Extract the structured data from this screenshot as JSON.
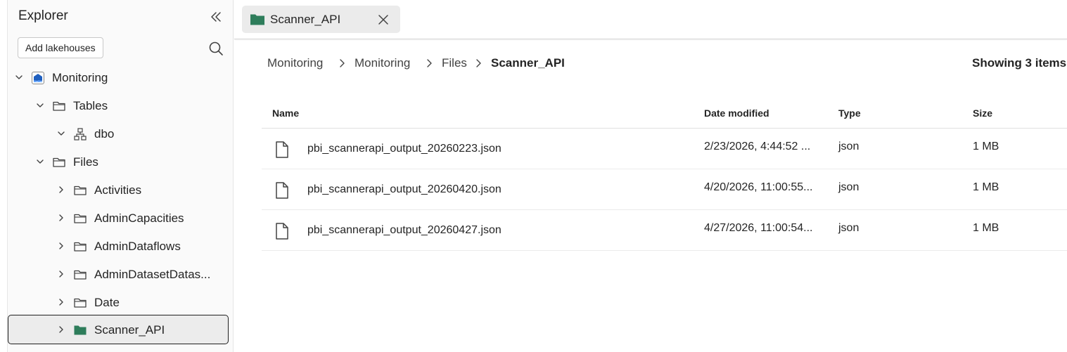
{
  "explorer": {
    "title": "Explorer",
    "add_button": "Add lakehouses",
    "tree": [
      {
        "label": "Monitoring",
        "icon": "lakehouse-icon",
        "expanded": true
      },
      {
        "label": "Tables",
        "icon": "folder-icon",
        "expanded": true
      },
      {
        "label": "dbo",
        "icon": "schema-icon",
        "expanded": true
      },
      {
        "label": "Files",
        "icon": "folder-icon",
        "expanded": true
      },
      {
        "label": "Activities",
        "icon": "folder-icon",
        "expanded": false
      },
      {
        "label": "AdminCapacities",
        "icon": "folder-icon",
        "expanded": false
      },
      {
        "label": "AdminDataflows",
        "icon": "folder-icon",
        "expanded": false
      },
      {
        "label": "AdminDatasetDatas...",
        "icon": "folder-icon",
        "expanded": false
      },
      {
        "label": "Date",
        "icon": "folder-icon",
        "expanded": false
      },
      {
        "label": "Scanner_API",
        "icon": "folder-filled-icon",
        "expanded": false,
        "selected": true
      }
    ]
  },
  "tab": {
    "label": "Scanner_API",
    "icon": "folder-filled-icon"
  },
  "breadcrumb": [
    "Monitoring",
    "Monitoring",
    "Files",
    "Scanner_API"
  ],
  "showing": "Showing 3 items",
  "table": {
    "columns": [
      "Name",
      "Date modified",
      "Type",
      "Size"
    ],
    "rows": [
      {
        "name": "pbi_scannerapi_output_20260223.json",
        "date": "2/23/2026, 4:44:52 ...",
        "type": "json",
        "size": "1 MB"
      },
      {
        "name": "pbi_scannerapi_output_20260420.json",
        "date": "4/20/2026, 11:00:55...",
        "type": "json",
        "size": "1 MB"
      },
      {
        "name": "pbi_scannerapi_output_20260427.json",
        "date": "4/27/2026, 11:00:54...",
        "type": "json",
        "size": "1 MB"
      }
    ]
  },
  "colors": {
    "folder_green": "#2e7d5b",
    "selected_bg": "#ececec",
    "lakehouse_blue": "#1f5fbf"
  }
}
